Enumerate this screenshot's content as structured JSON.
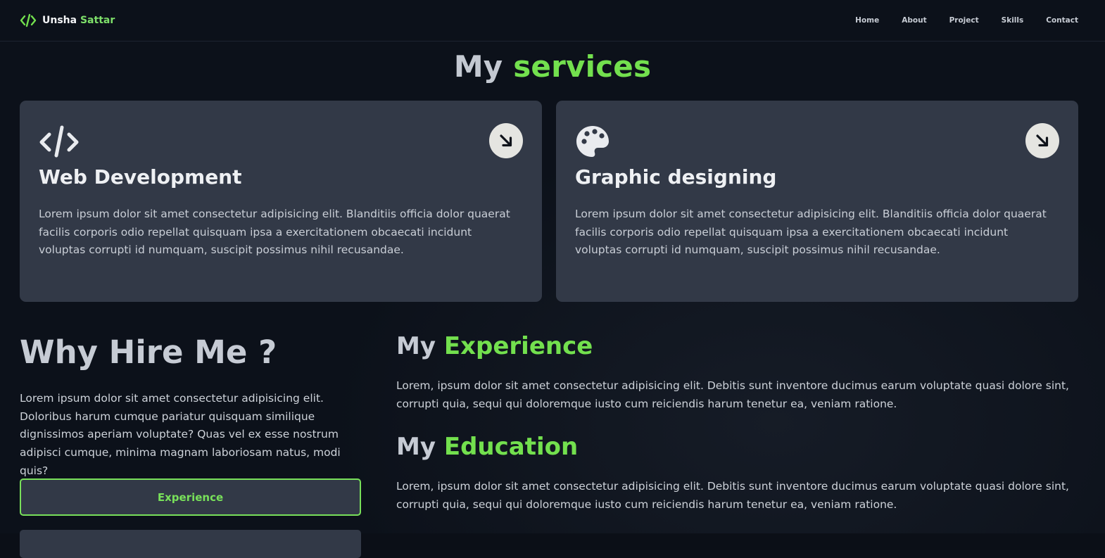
{
  "header": {
    "brand_name_first": "Unsha",
    "brand_name_second": "Sattar",
    "nav": [
      "Home",
      "About",
      "Project",
      "Skills",
      "Contact"
    ]
  },
  "services": {
    "title_prefix": "My",
    "title_accent": "services",
    "cards": [
      {
        "icon": "code-icon",
        "title": "Web Development",
        "text": "Lorem ipsum dolor sit amet consectetur adipisicing elit. Blanditiis officia dolor quaerat facilis corporis odio repellat quisquam ipsa a exercitationem obcaecati incidunt voluptas corrupti id numquam, suscipit possimus nihil recusandae."
      },
      {
        "icon": "palette-icon",
        "title": "Graphic designing",
        "text": "Lorem ipsum dolor sit amet consectetur adipisicing elit. Blanditiis officia dolor quaerat facilis corporis odio repellat quisquam ipsa a exercitationem obcaecati incidunt voluptas corrupti id numquam, suscipit possimus nihil recusandae."
      }
    ]
  },
  "why_hire": {
    "title": "Why Hire Me ?",
    "text": "Lorem ipsum dolor sit amet consectetur adipisicing elit. Doloribus harum cumque pariatur quisquam similique dignissimos aperiam voluptate? Quas vel ex esse nostrum adipisci cumque, minima magnam laboriosam natus, modi quis?",
    "experience_button": "Experience"
  },
  "experience": {
    "title_prefix": "My",
    "title_accent": "Experience",
    "text": "Lorem, ipsum dolor sit amet consectetur adipisicing elit. Debitis sunt inventore ducimus earum voluptate quasi dolore sint, corrupti quia, sequi qui doloremque iusto cum reiciendis harum tenetur ea, veniam ratione."
  },
  "education": {
    "title_prefix": "My",
    "title_accent": "Education",
    "text": "Lorem, ipsum dolor sit amet consectetur adipisicing elit. Debitis sunt inventore ducimus earum voluptate quasi dolore sint, corrupti quia, sequi qui doloremque iusto cum reiciendis harum tenetur ea, veniam ratione."
  },
  "colors": {
    "accent": "#73e04e",
    "background": "#0c111a",
    "card": "#323947"
  }
}
